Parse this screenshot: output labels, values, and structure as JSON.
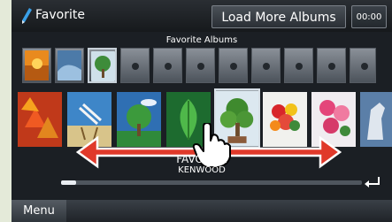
{
  "header": {
    "title": "Favorite",
    "load_more_label": "Load More Albums",
    "time": "00:00"
  },
  "favorite_albums_label": "Favorite Albums",
  "now_playing": {
    "album": "FAVORITE",
    "artist": "KENWOOD",
    "progress": 0.05
  },
  "footer": {
    "menu_label": "Menu"
  },
  "favorite_slots": [
    {
      "type": "thumb",
      "art": "sunset"
    },
    {
      "type": "thumb",
      "art": "wave"
    },
    {
      "type": "thumb",
      "art": "tree-selected"
    },
    {
      "type": "empty"
    },
    {
      "type": "empty"
    },
    {
      "type": "empty"
    },
    {
      "type": "empty"
    },
    {
      "type": "empty"
    },
    {
      "type": "empty"
    },
    {
      "type": "empty"
    },
    {
      "type": "empty"
    }
  ],
  "album_art": [
    "autumn-leaves",
    "beach-chair",
    "tree-sky",
    "leaf",
    "bonsai-tree",
    "flower-bouquet",
    "pink-flowers",
    "horse"
  ],
  "icons": [
    "pen-icon",
    "hand-pointer-icon",
    "double-arrow-icon",
    "return-icon"
  ],
  "colors": {
    "accent_arrow": "#e0392a",
    "screen_bg": "#1b1f24",
    "bezel": "#e4ead9"
  }
}
